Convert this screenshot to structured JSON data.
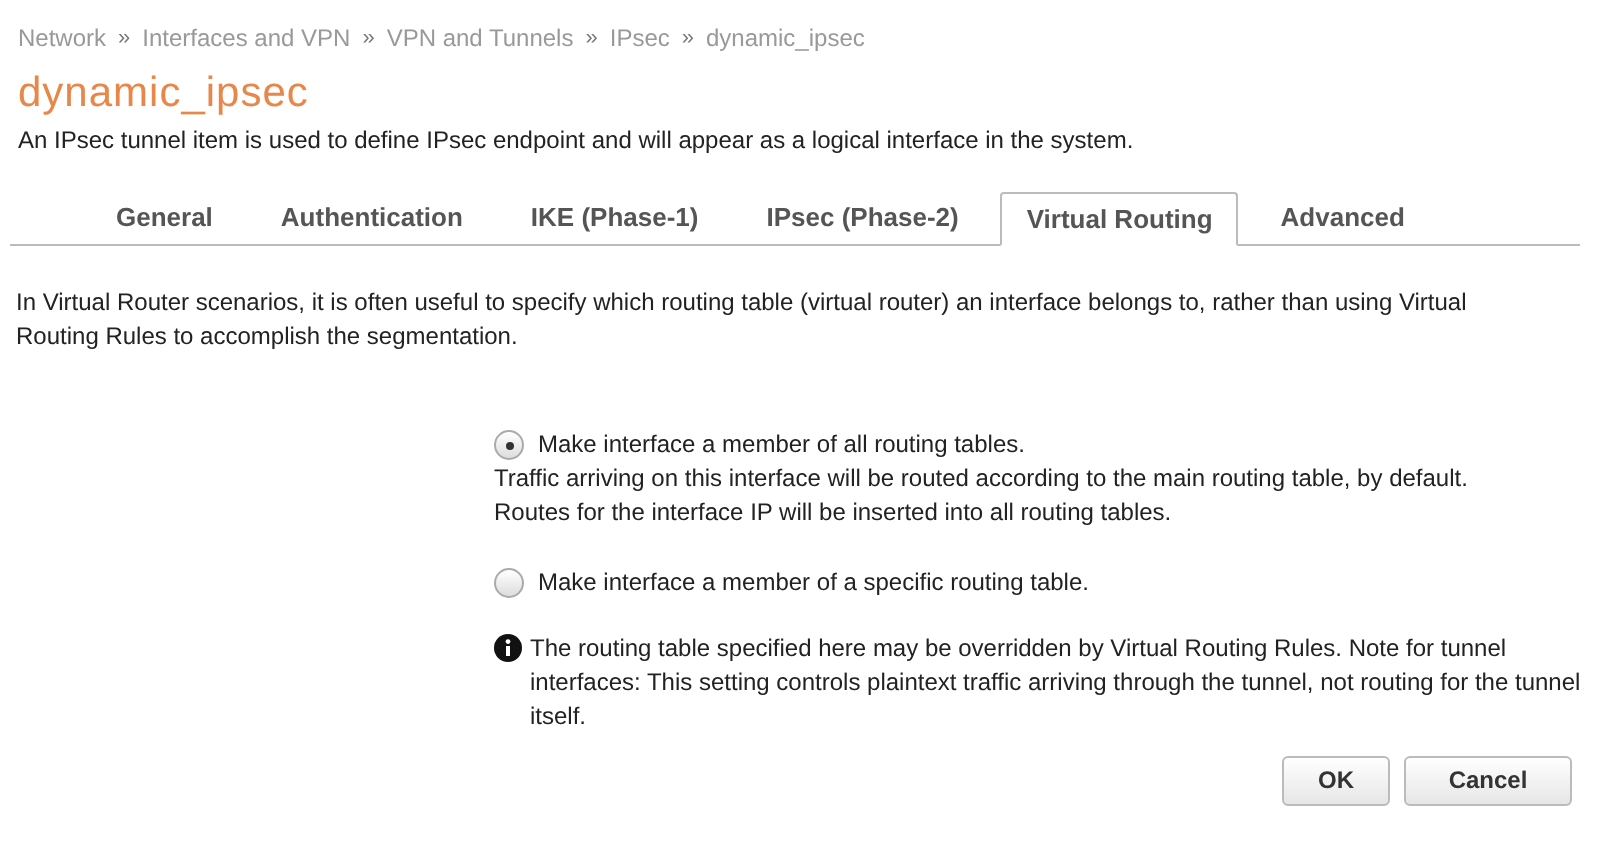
{
  "breadcrumb": [
    "Network",
    "Interfaces and VPN",
    "VPN and Tunnels",
    "IPsec",
    "dynamic_ipsec"
  ],
  "breadcrumb_separator": "»",
  "title": "dynamic_ipsec",
  "description": "An IPsec tunnel item is used to define IPsec endpoint and will appear as a logical interface in the system.",
  "tabs": [
    {
      "label": "General",
      "selected": false
    },
    {
      "label": "Authentication",
      "selected": false
    },
    {
      "label": "IKE (Phase-1)",
      "selected": false
    },
    {
      "label": "IPsec (Phase-2)",
      "selected": false
    },
    {
      "label": "Virtual Routing",
      "selected": true
    },
    {
      "label": "Advanced",
      "selected": false
    }
  ],
  "intro": "In Virtual Router scenarios, it is often useful to specify which routing table (virtual router) an interface belongs to, rather than using Virtual Routing Rules to accomplish the segmentation.",
  "options": [
    {
      "label": "Make interface a member of all routing tables.",
      "selected": true,
      "help": [
        "Traffic arriving on this interface will be routed according to the main routing table, by default.",
        "Routes for the interface IP will be inserted into all routing tables."
      ]
    },
    {
      "label": "Make interface a member of a specific routing table.",
      "selected": false
    }
  ],
  "note": "The routing table specified here may be overridden by Virtual Routing Rules. Note for tunnel interfaces: This setting controls plaintext traffic arriving through the tunnel, not routing for the tunnel itself.",
  "buttons": [
    "OK",
    "Cancel"
  ]
}
